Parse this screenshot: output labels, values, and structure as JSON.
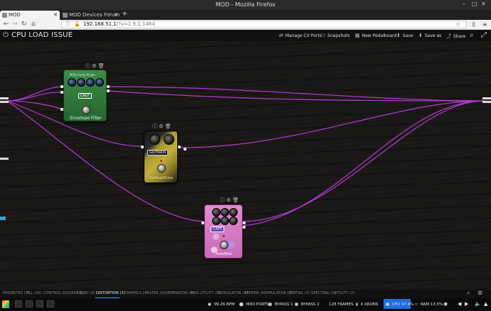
{
  "window": {
    "title": "MOD - Mozilla Firefox"
  },
  "tabs": [
    {
      "label": "MOD",
      "active": true
    },
    {
      "label": "MOD Devices Forum - F",
      "active": false
    }
  ],
  "address": {
    "host": "192.168.51.1",
    "path": "/?v=1.9.1.1464"
  },
  "header": {
    "title": "CPU LOAD ISSUE",
    "buttons": {
      "manage_cv": "Manage CV Ports",
      "snapshots": "Snapshots",
      "new_pedalboard": "New Pedalboard",
      "save": "Save",
      "save_as": "Save as",
      "share": "Share"
    }
  },
  "pedals": {
    "calf": {
      "badge": "CALF",
      "name": "Envelope Filter",
      "header": "MOD Audio Plugin"
    },
    "guitarix": {
      "badge": "GUITARIX",
      "name": "GxOverDrive"
    },
    "caps": {
      "badge": "CAPS",
      "name": "Autofilter"
    }
  },
  "categories": [
    "FAVORITES (7)",
    "ALL (42)",
    "CONTROL VOLTAGE (2)",
    "DELAY (2)",
    "DISTORTION (7)",
    "DYNAMICS (4)",
    "FILTER (0)",
    "GENERATOR (0)",
    "MIDI UTILITY (0)",
    "MODULATOR (12)",
    "REVERB (4)",
    "SIMULATOR (2)",
    "SPATIAL (2)",
    "SPECTRAL (0)",
    "UTILITY (2)"
  ],
  "status": {
    "bpm": "99.26 BPM",
    "midi": "MIDI PORTS",
    "bypass1": "BYPASS 1",
    "bypass2": "BYPASS 2",
    "frames": "128 FRAMES",
    "xruns": "4 XRUNS",
    "cpu": "CPU 37.4%",
    "ram": "RAM 13.5%"
  },
  "colors": {
    "cable": "#b43bd6",
    "cpu_accent": "#1f6ee0",
    "calf_green": "#2e7a3a",
    "gx_gold": "#9a8a2a",
    "caps_pink": "#d889c8"
  }
}
